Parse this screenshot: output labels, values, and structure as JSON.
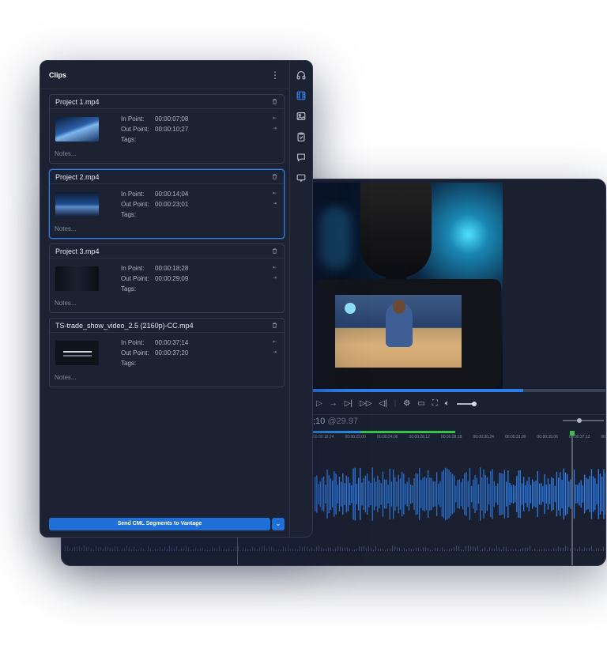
{
  "panel": {
    "title": "Clips",
    "menu_icon": "more-vertical-icon",
    "labels": {
      "in_point": "In Point:",
      "out_point": "Out Point:",
      "tags": "Tags:",
      "notes_placeholder": "Notes..."
    },
    "clips": [
      {
        "name": "Project 1.mp4",
        "in": "00:00:07;08",
        "out": "00:00:10;27",
        "selected": false
      },
      {
        "name": "Project 2.mp4",
        "in": "00:00:14;04",
        "out": "00:00:23;01",
        "selected": true
      },
      {
        "name": "Project 3.mp4",
        "in": "00:00:18;28",
        "out": "00:00:29;09",
        "selected": false
      },
      {
        "name": "TS-trade_show_video_2.5 (2160p)-CC.mp4",
        "in": "00:00:37;14",
        "out": "00:00:37;20",
        "selected": false
      }
    ],
    "send_button": "Send CML Segments to Vantage",
    "send_dropdown_icon": "chevron-down-icon",
    "accent_color": "#2f7de8"
  },
  "rail": {
    "icons": [
      "headphones-icon",
      "film-icon",
      "image-icon",
      "clipboard-check-icon",
      "comment-icon",
      "message-icon"
    ],
    "active": "film-icon"
  },
  "editor": {
    "timecode": ";10",
    "framerate": "@29.97",
    "playback_progress": 0.72,
    "control_icons": [
      "play-icon",
      "step-forward-icon",
      "next-frame-icon",
      "fast-forward-icon",
      "mark-out-icon",
      "settings-icon",
      "captions-icon",
      "fullscreen-icon",
      "volume-icon"
    ],
    "ruler": [
      "00:00:18;24",
      "00:00:22;00",
      "00:00:24;06",
      "00:00:28;12",
      "00:00:28;18",
      "00:00:30;24",
      "00:00:33;00",
      "00:00:35;06",
      "00:00:37;12",
      "00:00:3"
    ]
  }
}
